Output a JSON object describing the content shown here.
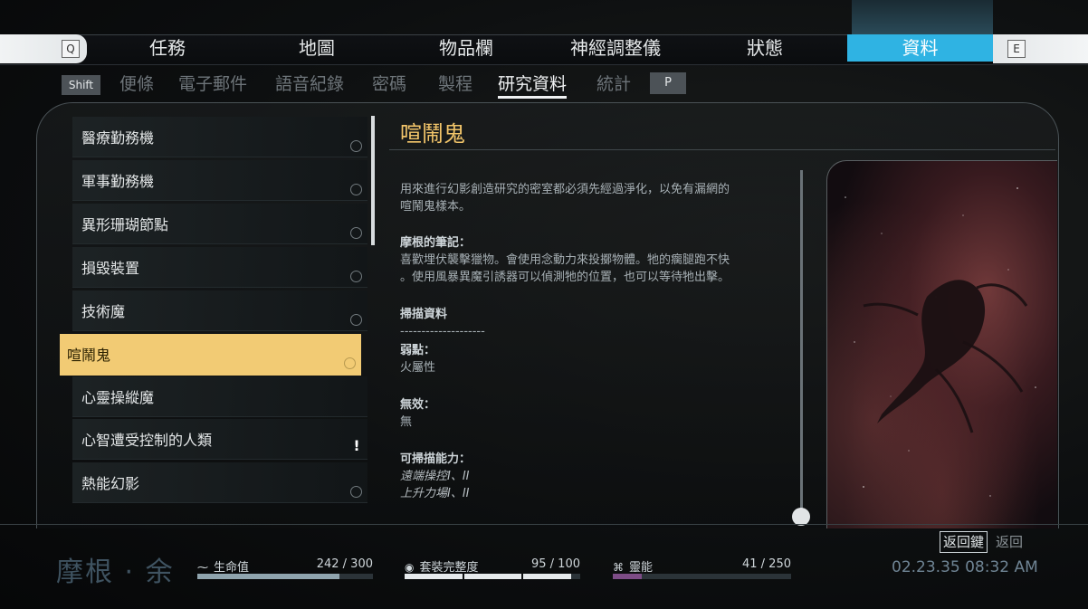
{
  "top_nav": {
    "q_key": "Q",
    "e_key": "E",
    "tabs": [
      "任務",
      "地圖",
      "物品欄",
      "神經調整儀",
      "狀態",
      "資料"
    ],
    "active_tab": "資料"
  },
  "sub_nav": {
    "shift_key": "Shift",
    "p_key": "P",
    "tabs": [
      "便條",
      "電子郵件",
      "語音紀錄",
      "密碼",
      "製程",
      "研究資料",
      "統計"
    ],
    "active_tab": "研究資料"
  },
  "list": {
    "items": [
      {
        "label": "醫療勤務機",
        "marker": "circle"
      },
      {
        "label": "軍事勤務機",
        "marker": "circle"
      },
      {
        "label": "異形珊瑚節點",
        "marker": "circle"
      },
      {
        "label": "損毀裝置",
        "marker": "circle"
      },
      {
        "label": "技術魔",
        "marker": "circle"
      },
      {
        "label": "喧鬧鬼",
        "marker": "circle",
        "selected": true
      },
      {
        "label": "心靈操縱魔",
        "marker": "none"
      },
      {
        "label": "心智遭受控制的人類",
        "marker": "exclamation"
      },
      {
        "label": "熱能幻影",
        "marker": "circle"
      }
    ]
  },
  "detail": {
    "title": "喧鬧鬼",
    "description_1": "用來進行幻影創造研究的密室都必須先經過淨化，以免有漏網的",
    "description_2": "喧鬧鬼樣本。",
    "notes_heading": "摩根的筆記：",
    "notes_1": "喜歡埋伏襲擊獵物。會使用念動力來投擲物體。牠的瘸腿跑不快",
    "notes_2": "。使用風暴異魔引誘器可以偵測牠的位置，也可以等待牠出擊。",
    "scan_heading": "掃描資料",
    "scan_divider": "--------------------",
    "weakness_heading": "弱點：",
    "weakness_value": "火屬性",
    "immune_heading": "無效：",
    "immune_value": "無",
    "abilities_heading": "可掃描能力：",
    "ability_1": "遠端操控I、II",
    "ability_2": "上升力場I、II"
  },
  "status": {
    "character_name": "摩根 · 余",
    "health": {
      "label": "生命值",
      "value": "242 / 300",
      "fraction": 0.807,
      "color": "#8fa4ae"
    },
    "suit": {
      "label": "套裝完整度",
      "value": "95 / 100",
      "fraction": 0.95,
      "color": "#e6eaec"
    },
    "psi": {
      "label": "靈能",
      "value": "41 / 250",
      "fraction": 0.164,
      "color": "#7d4c86"
    },
    "back_key": "返回鍵",
    "back_label": "返回",
    "clock": "02.23.35 08:32 AM"
  }
}
